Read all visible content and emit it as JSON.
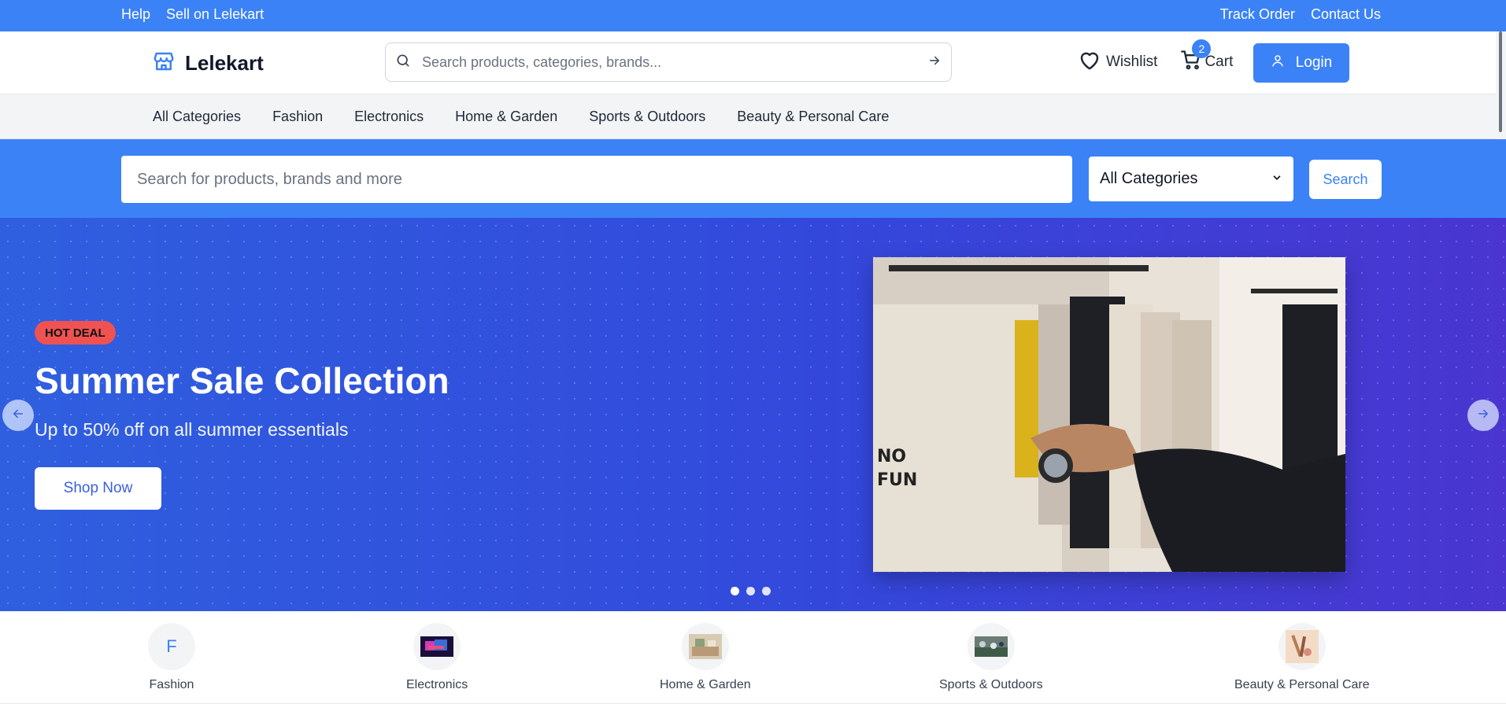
{
  "topbar": {
    "help": "Help",
    "sell": "Sell on Lelekart",
    "track": "Track Order",
    "contact": "Contact Us"
  },
  "header": {
    "logo_text": "Lelekart",
    "search_placeholder": "Search products, categories, brands...",
    "wishlist_label": "Wishlist",
    "cart_label": "Cart",
    "cart_count": "2",
    "login_label": "Login"
  },
  "category_nav": {
    "items": [
      "All Categories",
      "Fashion",
      "Electronics",
      "Home & Garden",
      "Sports & Outdoors",
      "Beauty & Personal Care"
    ]
  },
  "search_band": {
    "placeholder": "Search for products, brands and more",
    "category_select": "All Categories",
    "search_button": "Search"
  },
  "hero": {
    "badge": "HOT DEAL",
    "title": "Summer Sale Collection",
    "subtitle": "Up to 50% off on all summer essentials",
    "cta": "Shop Now",
    "active_slide": 1,
    "slide_count": 3
  },
  "categories": [
    {
      "label": "Fashion",
      "initial": "F",
      "icon": "letter-avatar"
    },
    {
      "label": "Electronics",
      "icon": "electronics-thumbnail"
    },
    {
      "label": "Home & Garden",
      "icon": "home-garden-thumbnail"
    },
    {
      "label": "Sports & Outdoors",
      "icon": "sports-thumbnail"
    },
    {
      "label": "Beauty & Personal Care",
      "icon": "beauty-thumbnail"
    }
  ],
  "colors": {
    "brand_blue": "#3b82f6",
    "hero_start": "#2f5fdf",
    "hero_end": "#4a35d0",
    "hot_badge": "#f05252"
  }
}
